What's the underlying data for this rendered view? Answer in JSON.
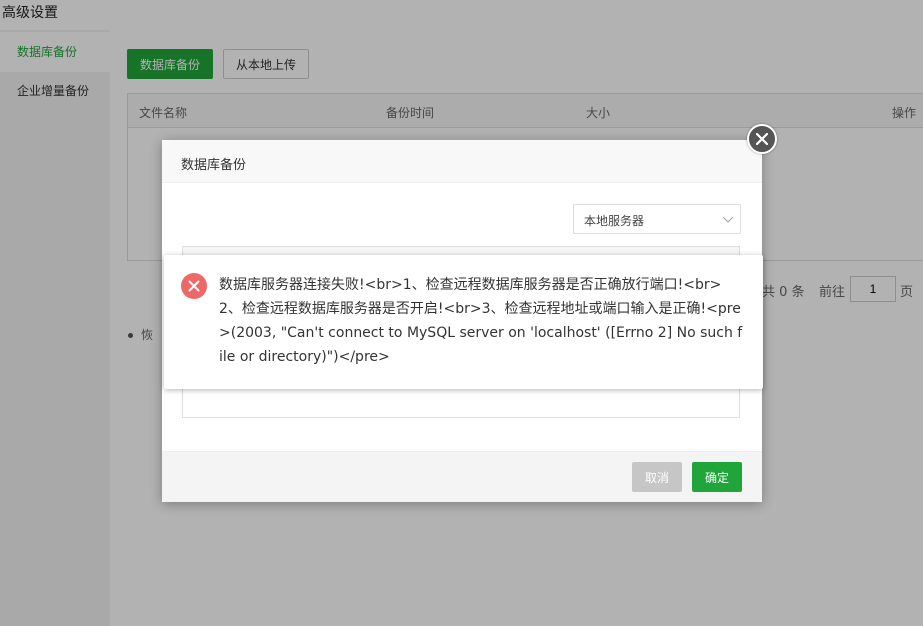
{
  "page": {
    "title": "高级设置"
  },
  "sidebar": {
    "items": [
      {
        "label": "数据库备份",
        "active": true
      },
      {
        "label": "企业增量备份",
        "active": false
      }
    ]
  },
  "toolbar": {
    "backup_label": "数据库备份",
    "upload_label": "从本地上传"
  },
  "table": {
    "columns": [
      "文件名称",
      "备份时间",
      "大小",
      "操作"
    ]
  },
  "pager": {
    "total": "共 0 条",
    "goto_prefix": "前往",
    "page_value": "1",
    "page_unit": "页"
  },
  "tips": {
    "text": "恢"
  },
  "dialog": {
    "title": "数据库备份",
    "server_select": {
      "value": "本地服务器"
    },
    "cancel_label": "取消",
    "ok_label": "确定"
  },
  "error_toast": {
    "message": "数据库服务器连接失败!<br>1、检查远程数据库服务器是否正确放行端口!<br>2、检查远程数据库服务器是否开启!<br>3、检查远程地址或端口输入是正确!<pre>(2003, \"Can't connect to MySQL server on 'localhost' ([Errno 2] No such file or directory)\")</pre>",
    "icon": "error-icon"
  },
  "colors": {
    "accent": "#20a53a",
    "error": "#ef6868",
    "close": "#555555"
  }
}
